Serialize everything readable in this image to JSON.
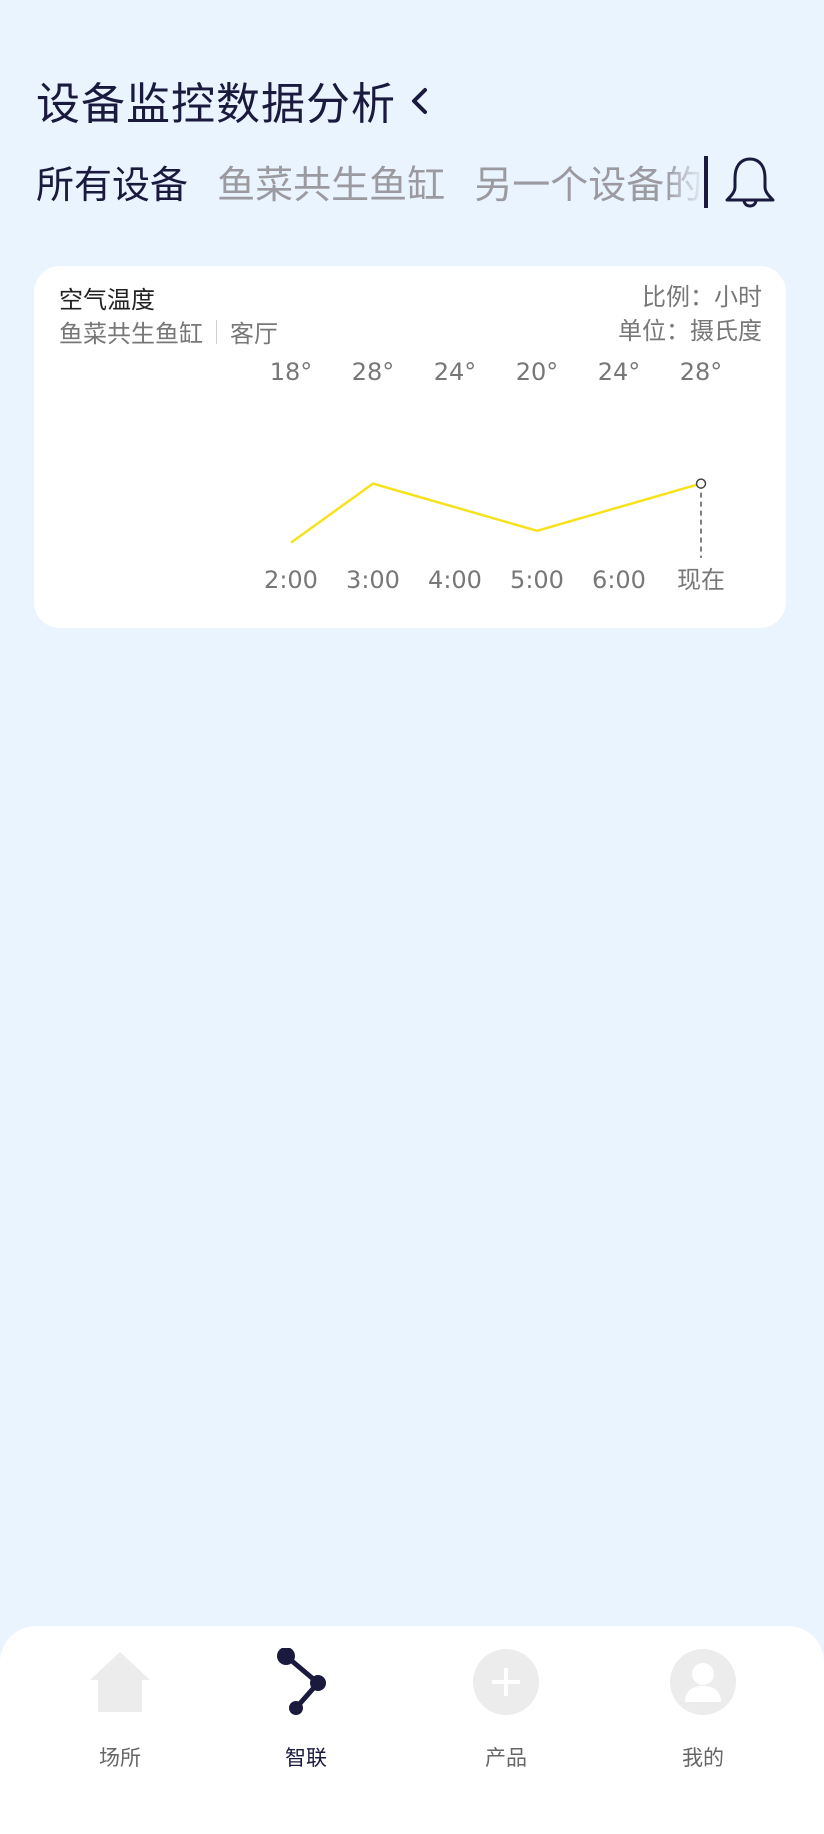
{
  "header": {
    "title": "设备监控数据分析"
  },
  "tabs": [
    {
      "label": "所有设备",
      "active": true
    },
    {
      "label": "鱼菜共生鱼缸",
      "active": false
    },
    {
      "label": "另一个设备的长",
      "active": false
    }
  ],
  "card": {
    "title": "空气温度",
    "device": "鱼菜共生鱼缸",
    "room": "客厅",
    "scale": "比例：小时",
    "unit": "单位：摄氏度"
  },
  "chart_data": {
    "type": "line",
    "title": "空气温度",
    "categories": [
      "2:00",
      "3:00",
      "4:00",
      "5:00",
      "6:00",
      "现在"
    ],
    "value_labels": [
      "18°",
      "28°",
      "24°",
      "20°",
      "24°",
      "28°"
    ],
    "series": [
      {
        "values": [
          18,
          28,
          24,
          20,
          24,
          28
        ]
      }
    ],
    "ylim": [
      12,
      32
    ],
    "colors": {
      "line": "#f6e21b",
      "marker": "#444444"
    },
    "grid": false,
    "legend": "none"
  },
  "tabbar": {
    "items": [
      {
        "label": "场所",
        "icon": "home-icon",
        "active": false
      },
      {
        "label": "智联",
        "icon": "share-nodes-icon",
        "active": true
      },
      {
        "label": "产品",
        "icon": "plus-circle-icon",
        "active": false
      },
      {
        "label": "我的",
        "icon": "user-icon",
        "active": false
      }
    ]
  },
  "colors": {
    "background": "#eaf4fe",
    "accent": "#1a1a3e",
    "inactive_icon": "#ececec"
  }
}
